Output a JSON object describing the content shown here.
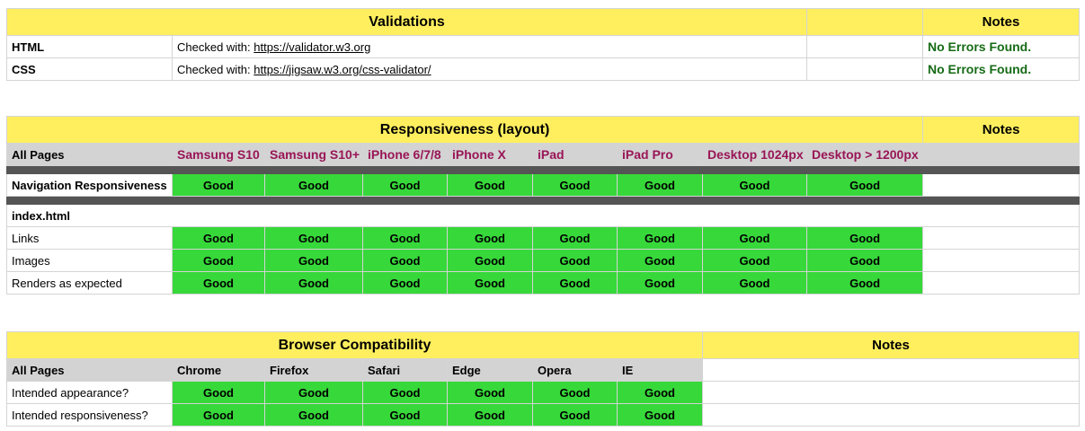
{
  "validations": {
    "title": "Validations",
    "notes_header": "Notes",
    "rows": [
      {
        "name": "HTML",
        "prefix": "Checked with:",
        "link": "https://validator.w3.org",
        "note": "No Errors Found."
      },
      {
        "name": "CSS",
        "prefix": "Checked with:",
        "link": "https://jigsaw.w3.org/css-validator/",
        "note": "No Errors Found."
      }
    ]
  },
  "responsiveness": {
    "title": "Responsiveness (layout)",
    "notes_header": "Notes",
    "row_header": "All Pages",
    "devices": [
      "Samsung S10",
      "Samsung S10+",
      "iPhone 6/7/8",
      "iPhone X",
      "iPad",
      "iPad Pro",
      "Desktop 1024px",
      "Desktop > 1200px"
    ],
    "nav_label": "Navigation Responsiveness",
    "nav_results": [
      "Good",
      "Good",
      "Good",
      "Good",
      "Good",
      "Good",
      "Good",
      "Good"
    ],
    "page_label": "index.html",
    "rows": [
      {
        "label": "Links",
        "results": [
          "Good",
          "Good",
          "Good",
          "Good",
          "Good",
          "Good",
          "Good",
          "Good"
        ]
      },
      {
        "label": "Images",
        "results": [
          "Good",
          "Good",
          "Good",
          "Good",
          "Good",
          "Good",
          "Good",
          "Good"
        ]
      },
      {
        "label": "Renders as expected",
        "results": [
          "Good",
          "Good",
          "Good",
          "Good",
          "Good",
          "Good",
          "Good",
          "Good"
        ]
      }
    ]
  },
  "browser": {
    "title": "Browser Compatibility",
    "notes_header": "Notes",
    "row_header": "All Pages",
    "browsers": [
      "Chrome",
      "Firefox",
      "Safari",
      "Edge",
      "Opera",
      "IE"
    ],
    "rows": [
      {
        "label": "Intended appearance?",
        "results": [
          "Good",
          "Good",
          "Good",
          "Good",
          "Good",
          "Good"
        ]
      },
      {
        "label": "Intended responsiveness?",
        "results": [
          "Good",
          "Good",
          "Good",
          "Good",
          "Good",
          "Good"
        ]
      }
    ]
  },
  "colors": {
    "header": "#ffef5e",
    "good": "#37d83a",
    "device_text": "#991556",
    "no_errors": "#166b16",
    "separator": "#555555"
  }
}
